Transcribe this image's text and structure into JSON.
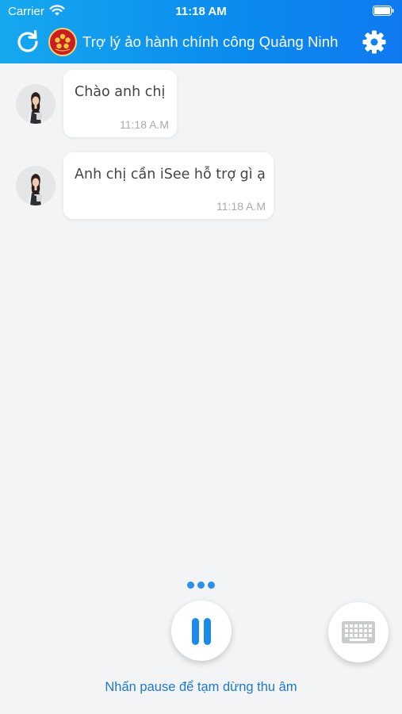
{
  "status_bar": {
    "carrier": "Carrier",
    "time": "11:18 AM",
    "wifi_icon": "wifi-icon",
    "battery_icon": "battery-icon"
  },
  "header": {
    "title": "Trợ lý ảo hành chính công Quảng Ninh",
    "refresh_icon": "refresh-icon",
    "logo": "emblem-logo",
    "settings_icon": "gear-icon",
    "gradient": [
      "#16a8ef",
      "#1079f0"
    ]
  },
  "messages": [
    {
      "text": "Chào anh chị",
      "time": "11:18 A.M"
    },
    {
      "text": "Anh chị cần iSee hỗ trợ gì ạ",
      "time": "11:18 A.M"
    }
  ],
  "controls": {
    "pause_icon": "pause-icon",
    "keyboard_icon": "keyboard-icon",
    "hint": "Nhấn pause để tạm dừng thu âm",
    "accent": "#1a8ce8"
  }
}
